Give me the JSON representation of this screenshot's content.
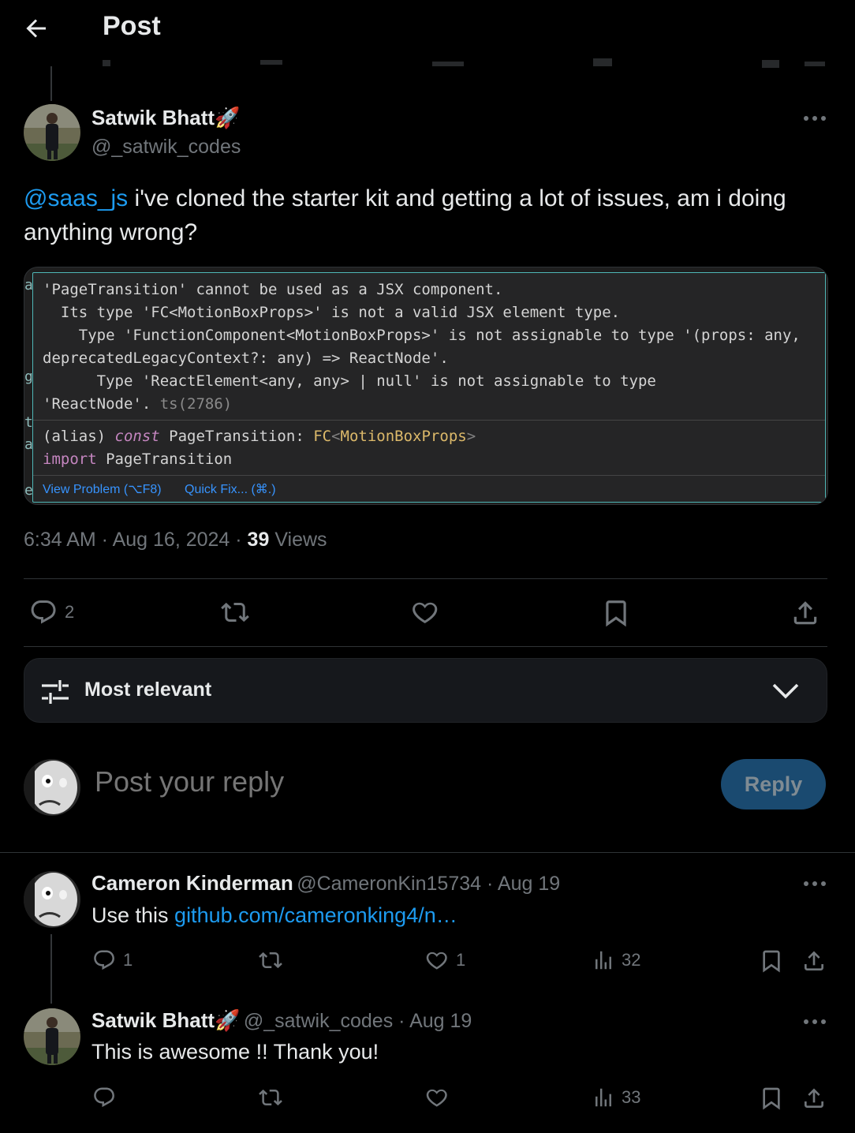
{
  "header": {
    "title": "Post"
  },
  "main_post": {
    "author_name": "Satwik Bhatt",
    "author_emoji": "🚀",
    "handle": "@_satwik_codes",
    "mention": "@saas_js",
    "text": " i've cloned the starter kit and getting a lot of issues, am i doing anything wrong?",
    "code_image": {
      "lines": [
        "'PageTransition' cannot be used as a JSX component.",
        "  Its type 'FC<MotionBoxProps>' is not a valid JSX element type.",
        "    Type 'FunctionComponent<MotionBoxProps>' is not assignable to type '(props: any,",
        "deprecatedLegacyContext?: any) => ReactNode'.",
        "      Type 'ReactElement<any, any> | null' is not assignable to type",
        "'ReactNode'."
      ],
      "ts_code": " ts(2786)",
      "alias_prefix": "(alias) ",
      "alias_keyword": "const",
      "alias_name": " PageTransition",
      "alias_colon": ": ",
      "alias_type": "FC",
      "alias_open": "<",
      "alias_generic": "MotionBoxProps",
      "alias_close": ">",
      "import_keyword": "import",
      "import_name": " PageTransition",
      "view_problem": "View Problem (⌥F8)",
      "quick_fix": "Quick Fix... (⌘.)"
    },
    "time": "6:34 AM",
    "date": "Aug 16, 2024",
    "views_count": "39",
    "views_label": "Views",
    "replies_count": "2"
  },
  "sort": {
    "label": "Most relevant"
  },
  "composer": {
    "placeholder": "Post your reply",
    "button": "Reply"
  },
  "replies": [
    {
      "author_name": "Cameron Kinderman",
      "handle": "@CameronKin15734",
      "date": "Aug 19",
      "text": "Use this ",
      "link": "github.com/cameronking4/n…",
      "replies": "1",
      "likes": "1",
      "views": "32"
    },
    {
      "author_name": "Satwik Bhatt",
      "author_emoji": "🚀",
      "handle": "@_satwik_codes",
      "date": "Aug 19",
      "text": "This is awesome !! Thank you!",
      "replies": "",
      "likes": "",
      "views": "33"
    }
  ],
  "separator": " · ",
  "icons": {
    "back": "arrow-left-icon",
    "more": "more-horizontal-icon",
    "reply": "speech-bubble-icon",
    "repost": "repost-icon",
    "like": "heart-icon",
    "bookmark": "bookmark-icon",
    "share": "share-upload-icon",
    "views": "bar-chart-icon",
    "sort": "sliders-icon",
    "chevron": "chevron-down-icon"
  },
  "colors": {
    "accent": "#1d9bf0",
    "muted": "#71767b",
    "text": "#e7e9ea",
    "background": "#000000"
  }
}
